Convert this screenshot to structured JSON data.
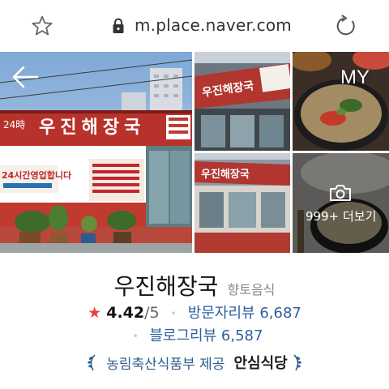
{
  "browser": {
    "url": "m.place.naver.com",
    "icons": {
      "favorite": "star-icon",
      "lock": "lock-icon",
      "reload": "reload-icon"
    }
  },
  "gallery": {
    "main_photo_alt": "restaurant storefront",
    "overlay": {
      "back_icon": "back-arrow-icon",
      "my_label": "MY",
      "more_label": "999+ 더보기",
      "camera_icon": "camera-icon"
    },
    "signs": {
      "storefront_name": "우진해장국",
      "open_notice": "24시간영업합니다",
      "hours": "24時"
    }
  },
  "place": {
    "name": "우진해장국",
    "category": "향토음식",
    "rating": {
      "value": "4.42",
      "max": "/5"
    },
    "visitor_reviews": "방문자리뷰 6,687",
    "blog_reviews": "블로그리뷰 6,587",
    "certification": {
      "text": "농림축산식품부 제공",
      "badge": "안심식당"
    }
  },
  "colors": {
    "rating_star": "#e8413e",
    "link": "#2c5fa0",
    "cert_text": "#2f5d8a",
    "category": "#8a8a8a"
  }
}
